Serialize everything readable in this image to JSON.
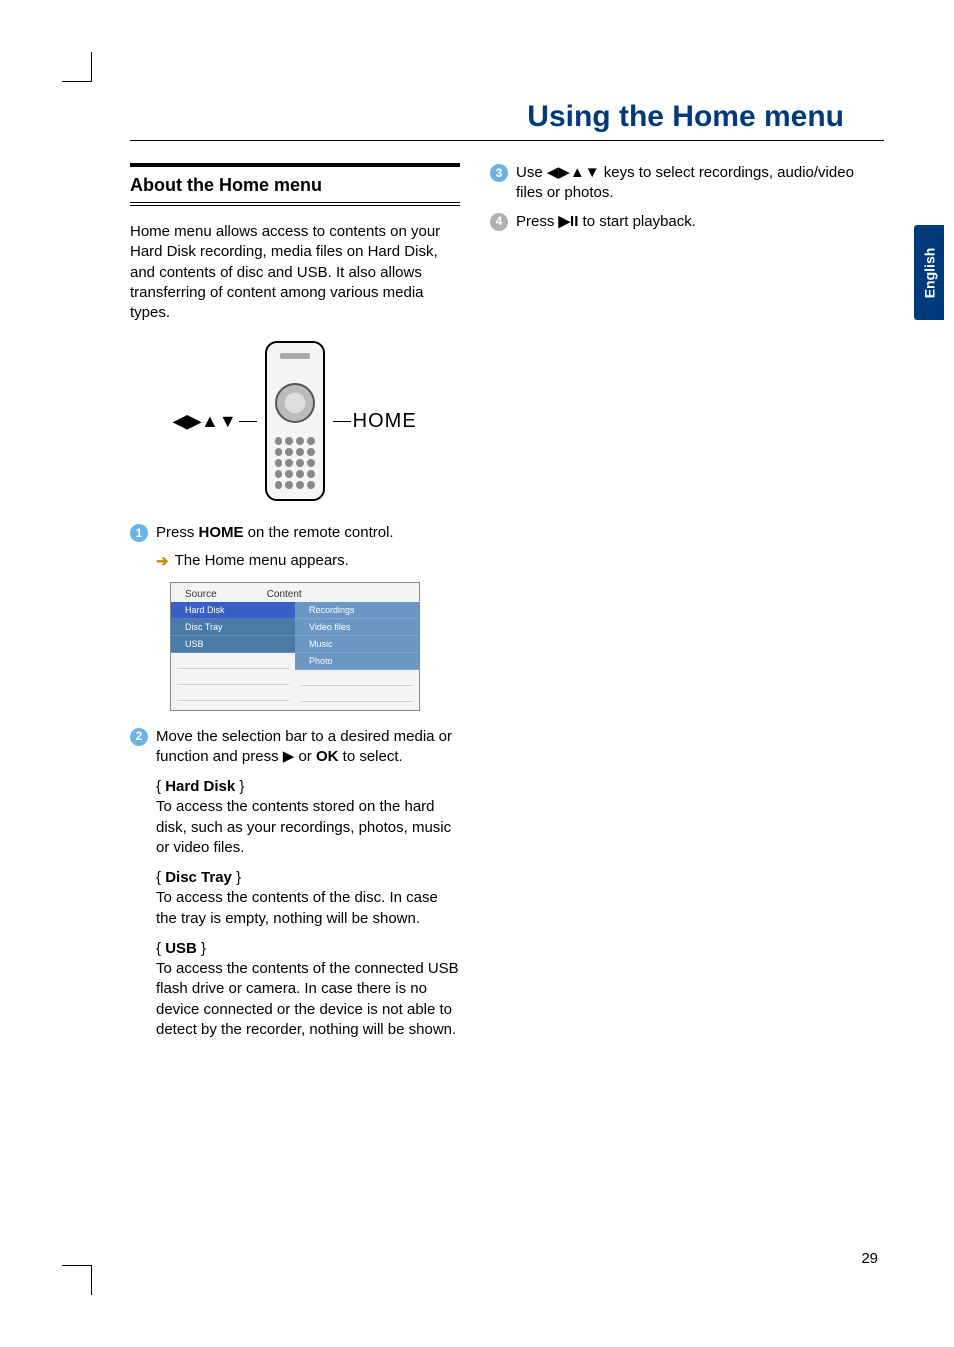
{
  "page": {
    "title": "Using the Home menu",
    "section_heading": "About the Home menu",
    "intro": "Home menu allows access to contents on your Hard Disk recording, media files on Hard Disk, and contents of disc and USB. It also allows transferring of content among various media types.",
    "language_tab": "English",
    "page_number": "29"
  },
  "diagram": {
    "nav_symbols": "◀▶▲▼",
    "home_label": "HOME"
  },
  "steps": {
    "s1_prefix": "Press ",
    "s1_bold": "HOME",
    "s1_suffix": " on the remote control.",
    "s1_result": "The Home menu appears.",
    "s2_prefix": "Move the selection bar to a desired media or function and press ",
    "s2_sym": "▶",
    "s2_mid": " or ",
    "s2_bold": "OK",
    "s2_suffix": " to select.",
    "s3_prefix": "Use ",
    "s3_sym": "◀▶▲▼",
    "s3_suffix": " keys to select recordings, audio/video files or photos.",
    "s4_prefix": "Press ",
    "s4_sym": "▶II",
    "s4_suffix": " to start playback."
  },
  "menu_screenshot": {
    "col1_header": "Source",
    "col2_header": "Content",
    "source_items": [
      "Hard Disk",
      "Disc Tray",
      "USB"
    ],
    "content_items": [
      "Recordings",
      "Video files",
      "Music",
      "Photo"
    ]
  },
  "options": {
    "hd_label": "Hard Disk",
    "hd_desc": "To access the contents stored on the hard disk, such as your recordings, photos, music or video files.",
    "dt_label": "Disc Tray",
    "dt_desc": "To access the contents of the disc. In case the tray is empty, nothing will be shown.",
    "usb_label": "USB",
    "usb_desc": "To access the contents of the connected USB flash drive or camera.  In case there is no device connected or the device is not able to detect by the recorder, nothing will be shown."
  }
}
